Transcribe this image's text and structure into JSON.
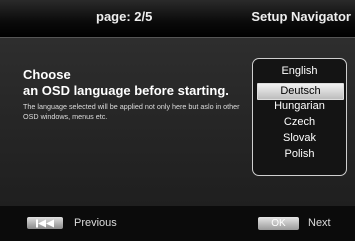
{
  "header": {
    "page_indicator": "page: 2/5",
    "title": "Setup Navigator"
  },
  "main": {
    "heading_line1": "Choose",
    "heading_line2": "an OSD language before starting.",
    "description": "The language selected will be applied not only here but aslo in other OSD windows, menus etc."
  },
  "languages": {
    "items": [
      "English",
      "Deutsch",
      "Hungarian",
      "Czech",
      "Slovak",
      "Polish"
    ],
    "selected": "Deutsch"
  },
  "footer": {
    "prev_key_icon": "skip-back-icon",
    "prev_label": "Previous",
    "ok_key_label": "OK",
    "next_label": "Next"
  }
}
